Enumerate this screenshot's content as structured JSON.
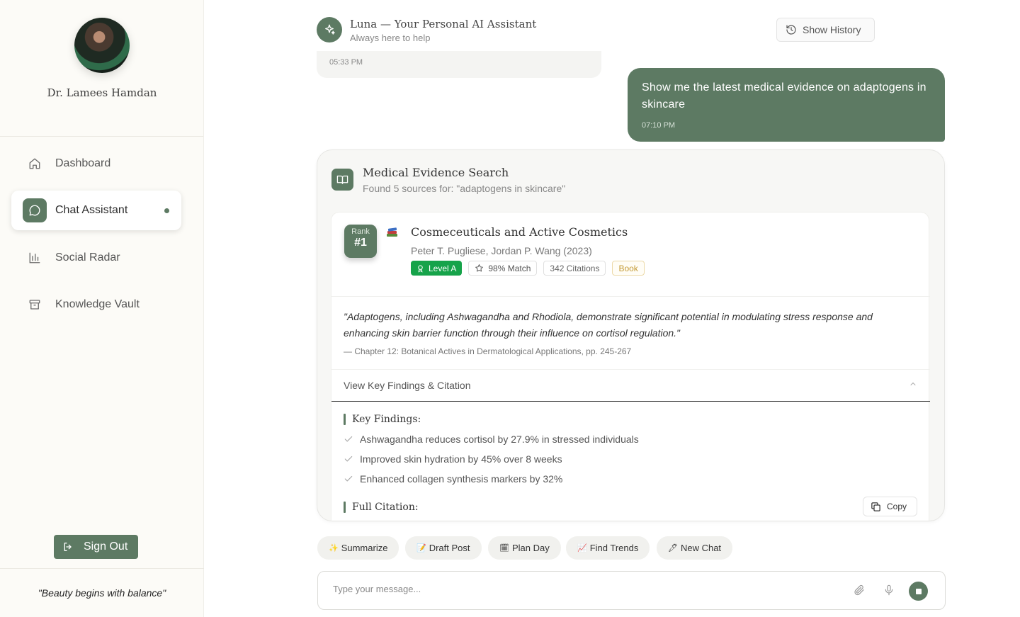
{
  "sidebar": {
    "profile_name": "Dr. Lamees Hamdan",
    "nav": [
      {
        "label": "Dashboard",
        "icon": "home-icon"
      },
      {
        "label": "Chat Assistant",
        "icon": "chat-bubble-icon",
        "active": true
      },
      {
        "label": "Social Radar",
        "icon": "bar-chart-icon"
      },
      {
        "label": "Knowledge Vault",
        "icon": "archive-icon"
      }
    ],
    "sign_out": "Sign Out",
    "footer_quote": "\"Beauty begins with balance\""
  },
  "header": {
    "assistant_name": "Luna — Your Personal AI Assistant",
    "assistant_sub": "Always here to help",
    "history_button": "Show History"
  },
  "messages": {
    "previous_time": "05:33 PM",
    "user_text": "Show me the latest medical evidence on adaptogens in skincare",
    "user_time": "07:10 PM"
  },
  "evidence": {
    "title": "Medical Evidence Search",
    "subtitle": "Found 5 sources for: \"adaptogens in skincare\"",
    "source": {
      "rank_label": "Rank",
      "rank": "#1",
      "title": "Cosmeceuticals and Active Cosmetics",
      "authors": "Peter T. Pugliese, Jordan P. Wang (2023)",
      "level": "Level A",
      "match": "98% Match",
      "citations": "342 Citations",
      "type": "Book",
      "quote": "\"Adaptogens, including Ashwagandha and Rhodiola, demonstrate significant potential in modulating stress response and enhancing skin barrier function through their influence on cortisol regulation.\"",
      "quote_source": "— Chapter 12: Botanical Actives in Dermatological Applications, pp. 245-267",
      "toggle_label": "View Key Findings & Citation",
      "key_findings_heading": "Key Findings:",
      "findings": [
        "Ashwagandha reduces cortisol by 27.9% in stressed individuals",
        "Improved skin hydration by 45% over 8 weeks",
        "Enhanced collagen synthesis markers by 32%"
      ],
      "full_citation_heading": "Full Citation:",
      "copy_button": "Copy"
    }
  },
  "quick_actions": [
    {
      "emoji": "✨",
      "label": "Summarize"
    },
    {
      "emoji": "📝",
      "label": "Draft Post"
    },
    {
      "emoji": "🗓",
      "label": "Plan Day"
    },
    {
      "emoji": "📈",
      "label": "Find Trends"
    },
    {
      "emoji": "🖊",
      "label": "New Chat"
    }
  ],
  "composer": {
    "placeholder": "Type your message..."
  },
  "colors": {
    "accent": "#5d7a63",
    "level_badge": "#16a34a",
    "book_badge": "#c49a35"
  }
}
